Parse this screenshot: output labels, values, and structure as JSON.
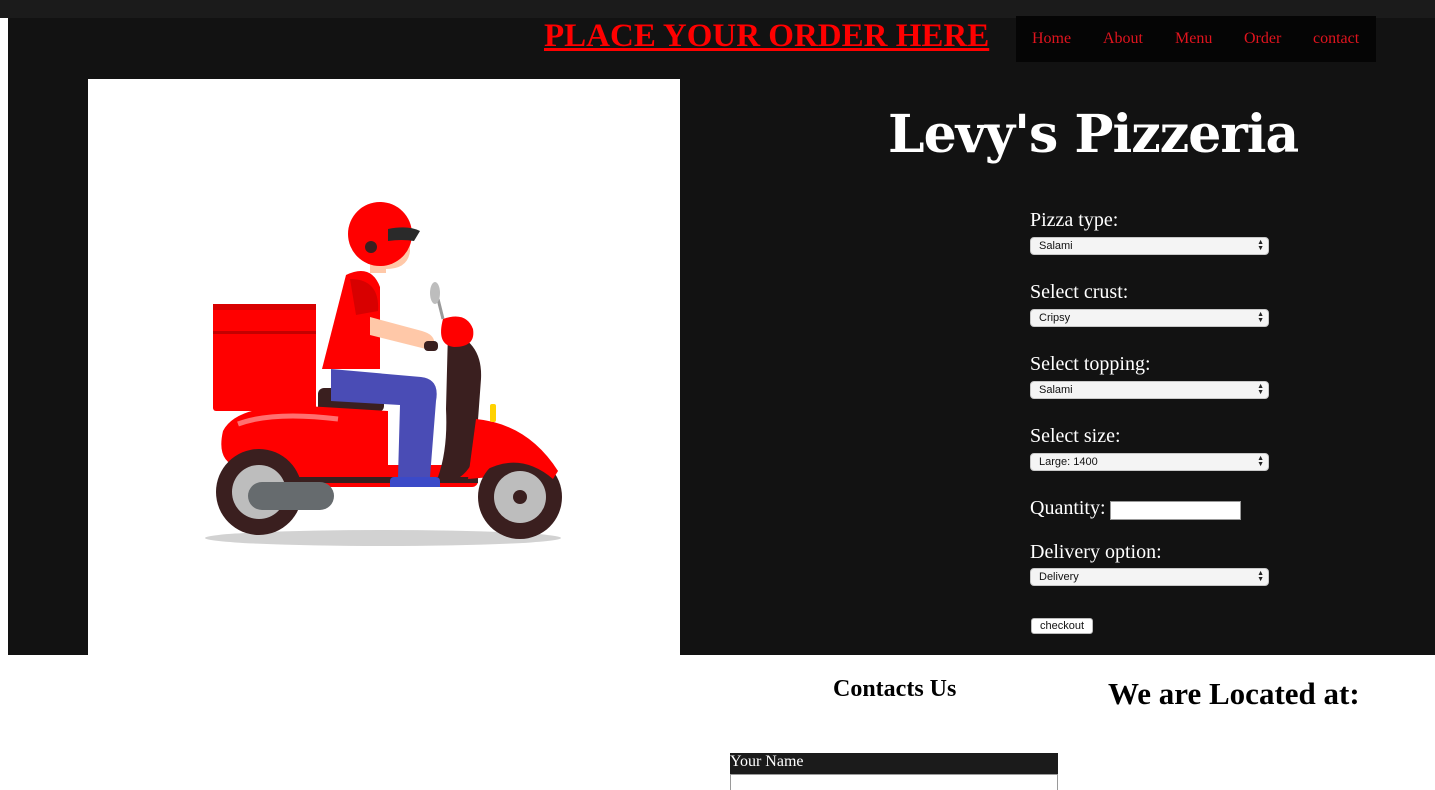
{
  "header": {
    "order_link": "PLACE YOUR ORDER HERE",
    "nav": [
      {
        "label": "Home"
      },
      {
        "label": "About"
      },
      {
        "label": "Menu"
      },
      {
        "label": "Order"
      },
      {
        "label": "contact"
      }
    ]
  },
  "brand": {
    "title": "Levy's Pizzeria"
  },
  "hero": {
    "icon": "delivery-scooter-illustration"
  },
  "form": {
    "pizza_type": {
      "label": "Pizza type:",
      "value": "Salami"
    },
    "crust": {
      "label": "Select crust:",
      "value": "Cripsy"
    },
    "topping": {
      "label": "Select topping:",
      "value": "Salami"
    },
    "size": {
      "label": "Select size:",
      "value": "Large: 1400"
    },
    "quantity": {
      "label": "Quantity:",
      "value": ""
    },
    "delivery": {
      "label": "Delivery option:",
      "value": "Delivery"
    },
    "checkout_label": "checkout"
  },
  "footer": {
    "contacts_title": "Contacts Us",
    "location_title": "We are Located at:",
    "name_label": "Your Name"
  },
  "colors": {
    "background": "#121212",
    "accent": "#ff0000",
    "nav_text": "#e0141e"
  }
}
